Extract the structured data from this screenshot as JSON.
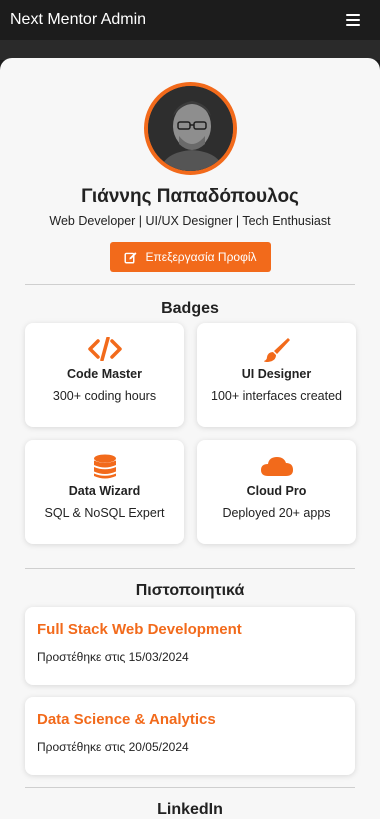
{
  "navbar": {
    "brand": "Next Mentor Admin",
    "menu_icon": "hamburger-icon"
  },
  "profile": {
    "name": "Γιάννης Παπαδόπουλος",
    "subtitle": "Web Developer | UI/UX Designer | Tech Enthusiast",
    "edit_label": "Επεξεργασία Προφίλ"
  },
  "badges": {
    "title": "Badges",
    "items": [
      {
        "icon": "code-icon",
        "title": "Code Master",
        "desc": "300+ coding hours"
      },
      {
        "icon": "paintbrush-icon",
        "title": "UI Designer",
        "desc": "100+ interfaces created"
      },
      {
        "icon": "database-icon",
        "title": "Data Wizard",
        "desc": "SQL & NoSQL Expert"
      },
      {
        "icon": "cloud-icon",
        "title": "Cloud Pro",
        "desc": "Deployed 20+ apps"
      }
    ]
  },
  "certificates": {
    "title": "Πιστοποιητικά",
    "items": [
      {
        "title": "Full Stack Web Development",
        "date": "Προστέθηκε στις 15/03/2024"
      },
      {
        "title": "Data Science & Analytics",
        "date": "Προστέθηκε στις 20/05/2024"
      }
    ]
  },
  "linkedin": {
    "title": "LinkedIn"
  },
  "colors": {
    "accent": "#f26a1b",
    "navbar": "#1c1c1c",
    "card_bg": "#f7f7f7"
  }
}
